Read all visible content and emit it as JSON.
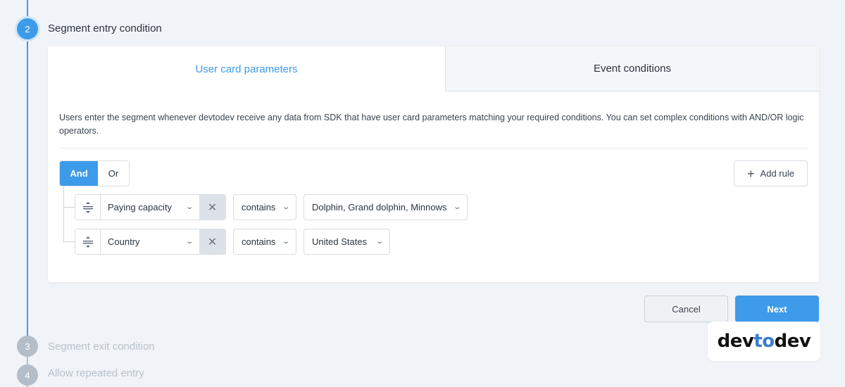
{
  "steps": [
    {
      "number": "2",
      "title": "Segment entry condition"
    },
    {
      "number": "3",
      "title": "Segment exit condition"
    },
    {
      "number": "4",
      "title": "Allow repeated entry"
    }
  ],
  "tabs": {
    "active": "User card parameters",
    "inactive": "Event conditions"
  },
  "description": "Users enter the segment whenever devtodev receive any data from SDK that have user card parameters matching your required conditions. You can set complex conditions with AND/OR logic operators.",
  "logic": {
    "and": "And",
    "or": "Or",
    "selected": "And"
  },
  "add_rule": "Add rule",
  "rules": [
    {
      "parameter": "Paying capacity",
      "operator": "contains",
      "value": "Dolphin, Grand dolphin, Minnows"
    },
    {
      "parameter": "Country",
      "operator": "contains",
      "value": "United States"
    }
  ],
  "buttons": {
    "cancel": "Cancel",
    "next": "Next"
  },
  "logo": {
    "part1": "dev",
    "part2": "to",
    "part3": "dev"
  },
  "colors": {
    "accent": "#3d9be9",
    "inactive_step": "#b4bec9"
  }
}
